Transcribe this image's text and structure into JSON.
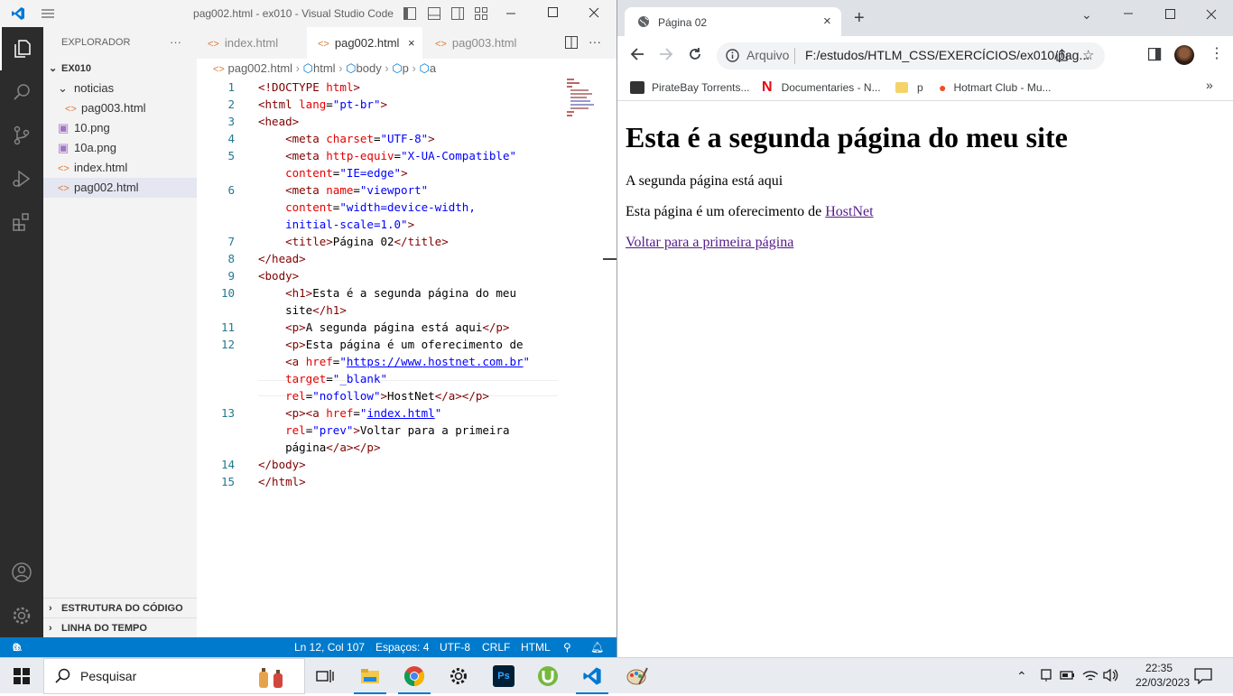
{
  "vscode": {
    "window_title": "pag002.html - ex010 - Visual Studio Code",
    "sidebar": {
      "header": "EXPLORADOR",
      "more": "···",
      "folder": "EX010",
      "items": [
        {
          "label": "noticias",
          "kind": "folder"
        },
        {
          "label": "pag003.html",
          "kind": "html"
        },
        {
          "label": "10.png",
          "kind": "image"
        },
        {
          "label": "10a.png",
          "kind": "image"
        },
        {
          "label": "index.html",
          "kind": "html"
        },
        {
          "label": "pag002.html",
          "kind": "html",
          "selected": true
        }
      ],
      "outline": "ESTRUTURA DO CÓDIGO",
      "timeline": "LINHA DO TEMPO"
    },
    "tabs": [
      {
        "label": "index.html",
        "active": false
      },
      {
        "label": "pag002.html",
        "active": true
      },
      {
        "label": "pag003.html",
        "active": false
      }
    ],
    "breadcrumb": [
      "pag002.html",
      "html",
      "body",
      "p",
      "a"
    ],
    "line_numbers": [
      "1",
      "2",
      "3",
      "4",
      "5",
      "",
      "6",
      "",
      "",
      "7",
      "8",
      "9",
      "10",
      "",
      "11",
      "12",
      "",
      "",
      "",
      "13",
      "",
      "",
      "14",
      "15"
    ],
    "status": {
      "errors": "0",
      "warnings": "0",
      "position": "Ln 12, Col 107",
      "spaces": "Espaços: 4",
      "encoding": "UTF-8",
      "eol": "CRLF",
      "language": "HTML"
    }
  },
  "chrome": {
    "tab_title": "Página 02",
    "address_prefix": "Arquivo",
    "address": "F:/estudos/HTLM_CSS/EXERCÍCIOS/ex010/pag...",
    "bookmarks": [
      {
        "label": "PirateBay Torrents...",
        "icon": "piratebay-icon"
      },
      {
        "label": "Documentaries - N...",
        "icon": "netflix-icon"
      },
      {
        "label": "p",
        "icon": "folder-icon"
      },
      {
        "label": "Hotmart Club - Mu...",
        "icon": "hotmart-icon"
      }
    ],
    "page": {
      "heading": "Esta é a segunda página do meu site",
      "p1": "A segunda página está aqui",
      "p2_text": "Esta página é um oferecimento de ",
      "p2_link": "HostNet",
      "p3_link": "Voltar para a primeira página"
    }
  },
  "taskbar": {
    "search_placeholder": "Pesquisar",
    "time": "22:35",
    "date": "22/03/2023"
  }
}
